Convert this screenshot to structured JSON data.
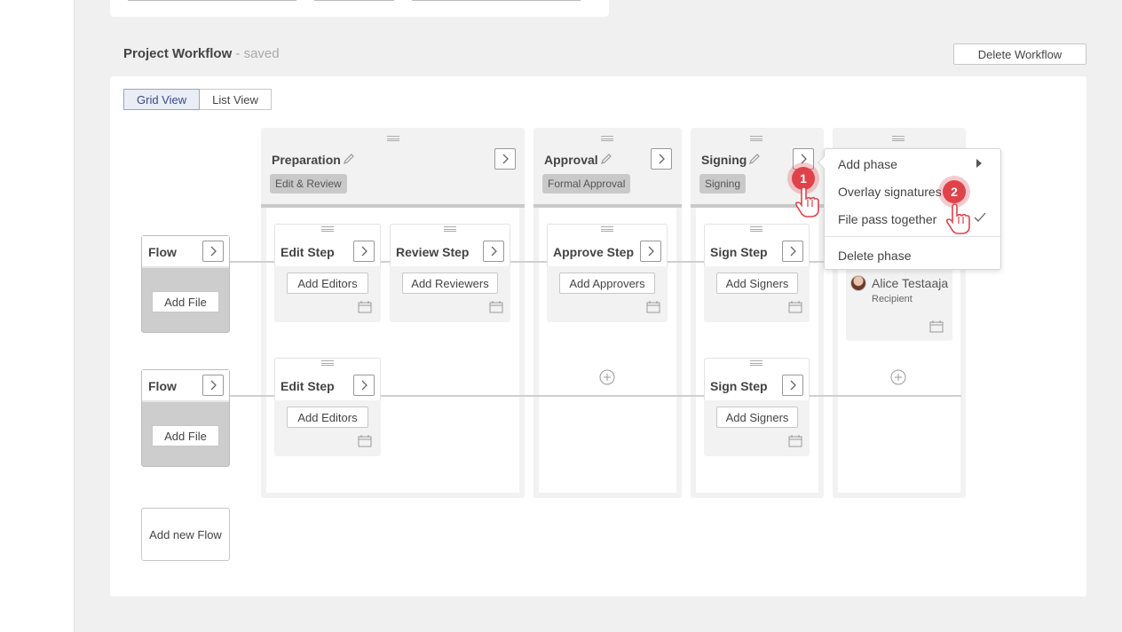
{
  "section": {
    "title": "Project Workflow",
    "status": " - saved"
  },
  "toolbar": {
    "delete_workflow": "Delete Workflow"
  },
  "views": {
    "grid": "Grid View",
    "list": "List View",
    "active": "Grid View"
  },
  "phases": [
    {
      "title": "Preparation",
      "tag": "Edit & Review"
    },
    {
      "title": "Approval",
      "tag": "Formal Approval"
    },
    {
      "title": "Signing",
      "tag": "Signing"
    }
  ],
  "flows": [
    {
      "title": "Flow",
      "add_file": "Add File"
    },
    {
      "title": "Flow",
      "add_file": "Add File"
    }
  ],
  "steps": {
    "row1": [
      {
        "title": "Edit Step",
        "action": "Add Editors"
      },
      {
        "title": "Review Step",
        "action": "Add Reviewers"
      },
      {
        "title": "Approve Step",
        "action": "Add Approvers"
      },
      {
        "title": "Sign Step",
        "action": "Add Signers"
      }
    ],
    "row2": [
      {
        "title": "Edit Step",
        "action": "Add Editors"
      },
      {
        "title": "Sign Step",
        "action": "Add Signers"
      }
    ]
  },
  "recipient": {
    "name": "Alice Testaaja",
    "role": "Recipient"
  },
  "add_new_flow": "Add new Flow",
  "context_menu": {
    "items": [
      {
        "label": "Add phase",
        "submenu": true
      },
      {
        "label": "Overlay signatures"
      },
      {
        "label": "File pass together",
        "checked": true
      },
      {
        "label": "Delete phase"
      }
    ]
  },
  "markers": [
    "1",
    "2"
  ],
  "colors": {
    "marker": "#e0424a",
    "active_view": "#3a4a8a",
    "tag_bg": "#c9c9c9"
  }
}
